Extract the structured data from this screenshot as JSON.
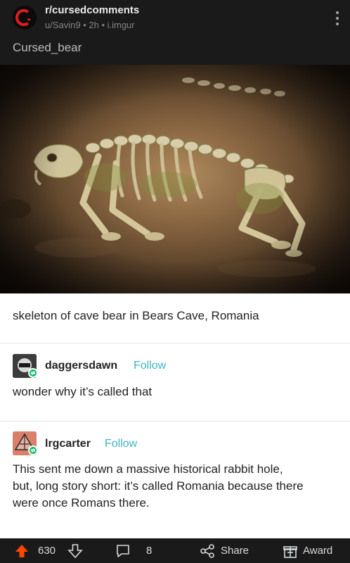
{
  "post": {
    "subreddit": "r/cursedcomments",
    "author_meta": "u/Savin9 • 2h • i.imgur",
    "title": "Cursed_bear"
  },
  "tumblr": {
    "caption": "skeleton of cave bear in Bears Cave, Romania",
    "comments": [
      {
        "username": "daggersdawn",
        "follow_label": "Follow",
        "text": "wonder why it’s called that"
      },
      {
        "username": "lrgcarter",
        "follow_label": "Follow",
        "text_lines": [
          "This sent me down a massive historical rabbit hole,",
          "but, long story short: it’s called Romania because there",
          "were once Romans there."
        ]
      }
    ]
  },
  "actions": {
    "upvotes": "630",
    "comments": "8",
    "share_label": "Share",
    "award_label": "Award"
  },
  "colors": {
    "upvote": "#ff4500",
    "follow": "#3fb4bf",
    "reblog": "#00b95f"
  },
  "icons": [
    "subreddit-icon",
    "more-options-icon",
    "upvote-icon",
    "downvote-icon",
    "comment-icon",
    "share-icon",
    "award-icon",
    "reblog-icon"
  ]
}
